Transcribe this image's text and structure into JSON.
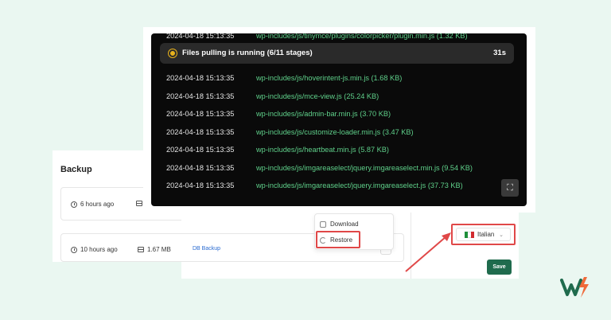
{
  "backup": {
    "title": "Backup",
    "rows": [
      {
        "time": "6 hours ago",
        "size": "",
        "type": ""
      },
      {
        "time": "10 hours ago",
        "size": "1.67 MB",
        "type": "DB Backup"
      }
    ]
  },
  "menu": {
    "download_label": "Download",
    "restore_label": "Restore"
  },
  "language": {
    "selected": "Italian",
    "flag_colors": [
      "#1f8f3a",
      "#ffffff",
      "#d12a2f"
    ]
  },
  "save_label": "Save",
  "terminal": {
    "status_text": "Files pulling is running (6/11 stages)",
    "elapsed": "31s",
    "clipped_line": {
      "timestamp": "2024-04-18 15:13:35",
      "file": "wp-includes/js/tinymce/plugins/colorpicker/plugin.min.js (1.32 KB)"
    },
    "lines": [
      {
        "timestamp": "2024-04-18 15:13:35",
        "file": "wp-includes/js/hoverintent-js.min.js (1.68 KB)"
      },
      {
        "timestamp": "2024-04-18 15:13:35",
        "file": "wp-includes/js/mce-view.js (25.24 KB)"
      },
      {
        "timestamp": "2024-04-18 15:13:35",
        "file": "wp-includes/js/admin-bar.min.js (3.70 KB)"
      },
      {
        "timestamp": "2024-04-18 15:13:35",
        "file": "wp-includes/js/customize-loader.min.js (3.47 KB)"
      },
      {
        "timestamp": "2024-04-18 15:13:35",
        "file": "wp-includes/js/heartbeat.min.js (5.87 KB)"
      },
      {
        "timestamp": "2024-04-18 15:13:35",
        "file": "wp-includes/js/imgareaselect/jquery.imgareaselect.min.js (9.54 KB)"
      },
      {
        "timestamp": "2024-04-18 15:13:35",
        "file": "wp-includes/js/imgareaselect/jquery.imgareaselect.js (37.73 KB)"
      }
    ]
  },
  "colors": {
    "accent_red": "#e04848",
    "file_green": "#5fd08a",
    "save_green": "#1f6b4d",
    "status_yellow": "#e8b21c"
  },
  "icons": {
    "time": "clock-icon",
    "size": "database-icon",
    "download": "download-icon",
    "restore": "restore-icon",
    "expand": "expand-icon",
    "logo": "brand-logo"
  }
}
